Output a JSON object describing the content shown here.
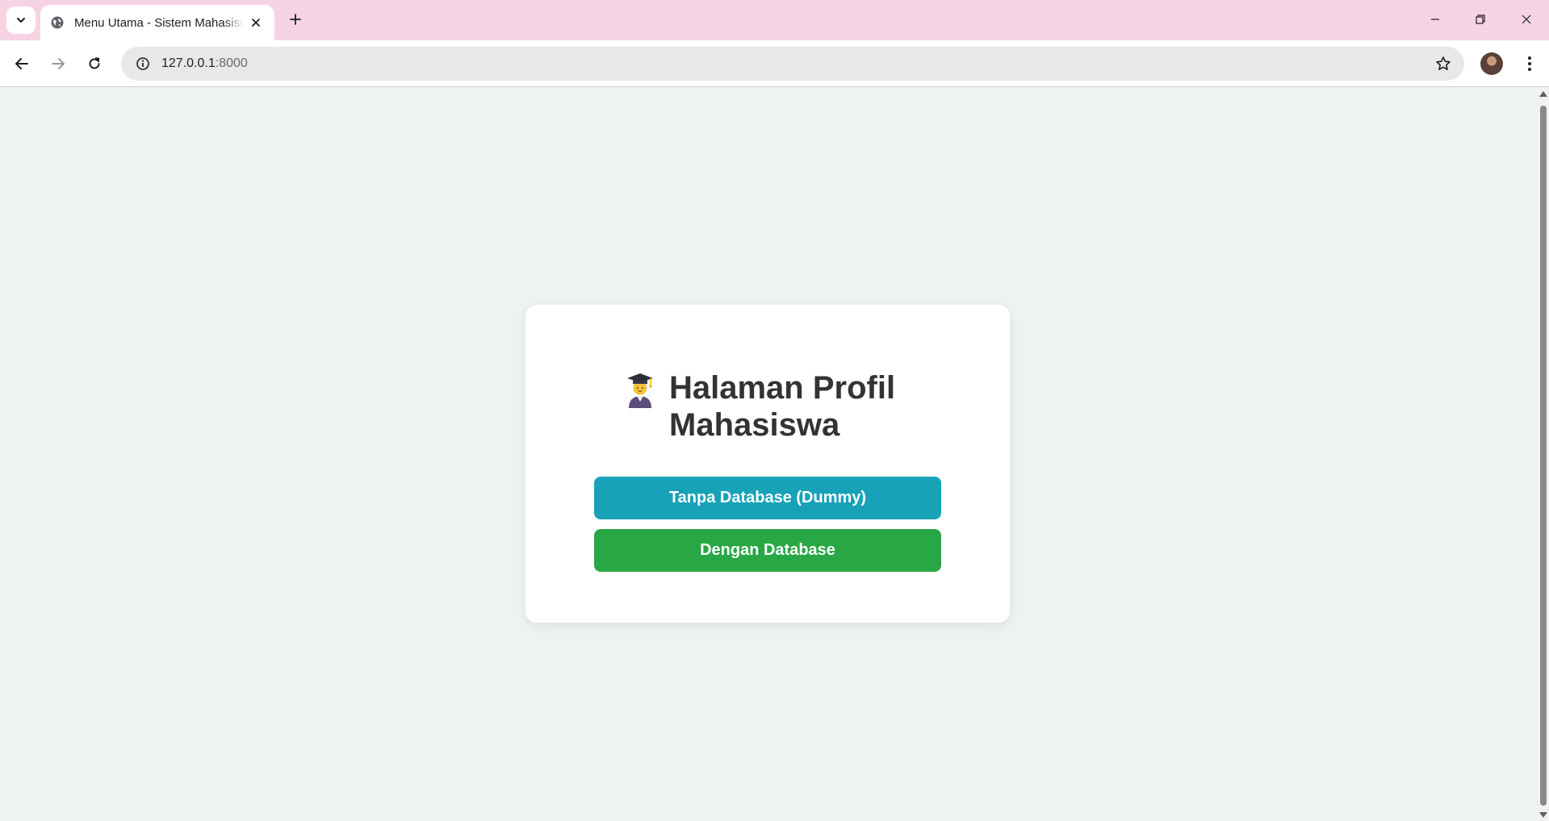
{
  "browser": {
    "tab": {
      "title": "Menu Utama - Sistem Mahasiswa",
      "favicon": "globe-icon"
    },
    "address_bar": {
      "host": "127.0.0.1",
      "port": ":8000"
    },
    "window_controls": [
      "minimize-icon",
      "restore-icon",
      "close-icon"
    ]
  },
  "page": {
    "heading_emoji": "student-graduation-icon",
    "heading": "Halaman Profil Mahasiswa",
    "buttons": {
      "dummy": "Tanpa Database (Dummy)",
      "database": "Dengan Database"
    }
  },
  "colors": {
    "tab_strip": "#f6d3e3",
    "page_background": "#eef2f3",
    "button_dummy": "#17a2b8",
    "button_database": "#28a745",
    "heading_text": "#333333"
  }
}
